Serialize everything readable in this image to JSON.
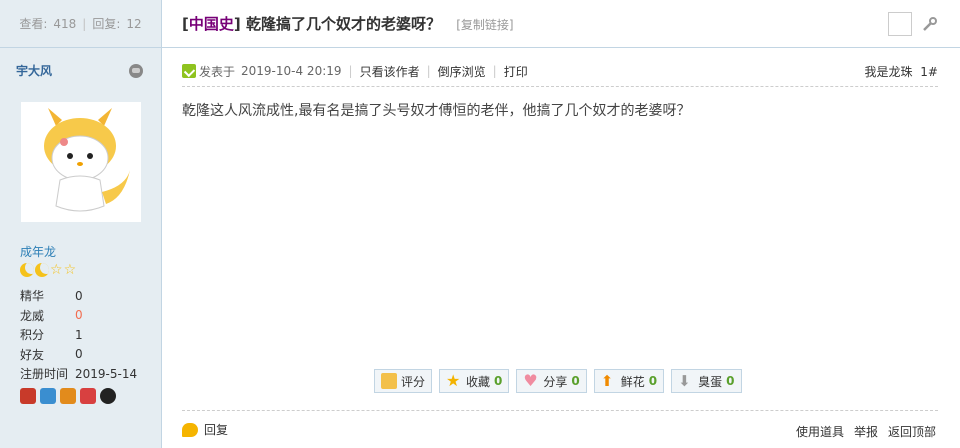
{
  "sidebar": {
    "views_label": "查看:",
    "views": "418",
    "replies_label": "回复:",
    "replies": "12",
    "author": "宇大风",
    "rank": "成年龙",
    "stats": [
      {
        "k": "精华",
        "v": "0"
      },
      {
        "k": "龙威",
        "v": "0"
      },
      {
        "k": "积分",
        "v": "1"
      },
      {
        "k": "好友",
        "v": "0"
      },
      {
        "k": "注册时间",
        "v": "2019-5-14"
      }
    ]
  },
  "thread": {
    "category": "中国史",
    "title": "乾隆搞了几个奴才的老婆呀？",
    "copy_link": "[复制链接]"
  },
  "post": {
    "posted_label": "发表于",
    "posted_time": "2019-10-4 20:19",
    "only_author": "只看该作者",
    "reverse": "倒序浏览",
    "print": "打印",
    "floor_label": "我是龙珠",
    "floor": "1#",
    "content": "乾隆这人风流成性,最有名是搞了头号奴才傅恒的老伴，他搞了几个奴才的老婆呀？"
  },
  "actions": [
    {
      "label": "评分",
      "count": ""
    },
    {
      "label": "收藏",
      "count": "0"
    },
    {
      "label": "分享",
      "count": "0"
    },
    {
      "label": "鲜花",
      "count": "0"
    },
    {
      "label": "臭蛋",
      "count": "0"
    }
  ],
  "footer": {
    "reply": "回复",
    "use_tool": "使用道具",
    "report": "举报",
    "back_top": "返回顶部"
  },
  "colors": {
    "sidebar_bg": "#e5edf2",
    "category": "#770077",
    "accent": "#336699"
  }
}
